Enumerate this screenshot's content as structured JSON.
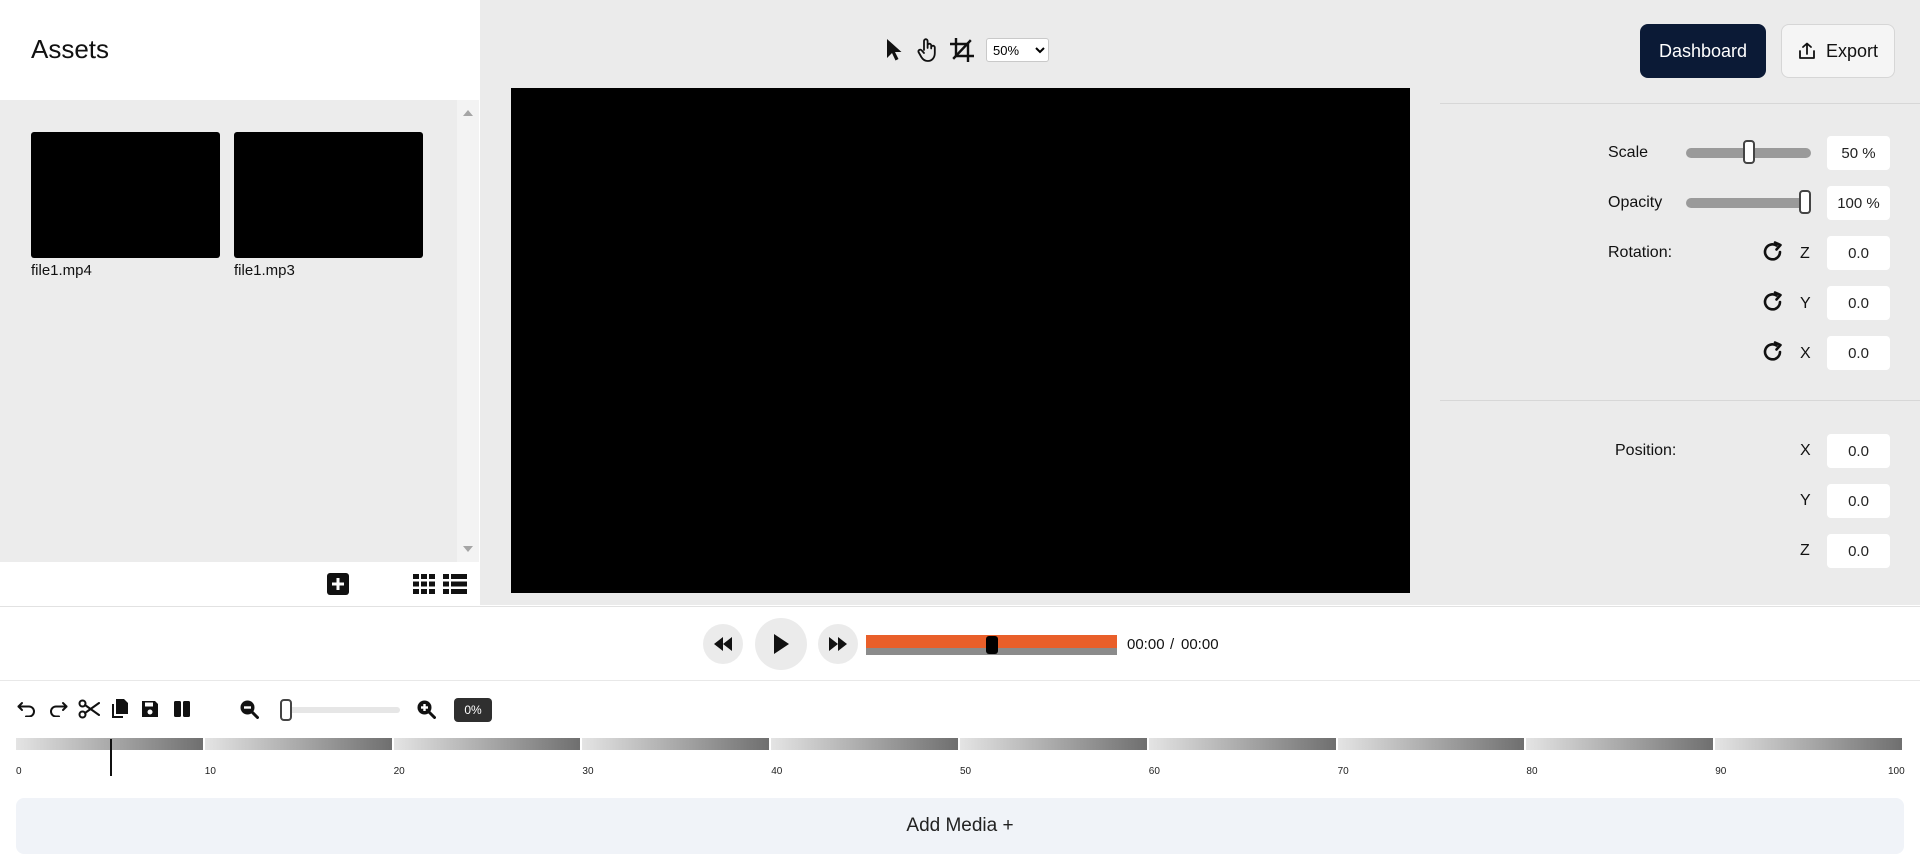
{
  "assets": {
    "title": "Assets",
    "items": [
      {
        "name": "file1.mp4"
      },
      {
        "name": "file1.mp3"
      }
    ]
  },
  "viewer": {
    "zoom_value": "50%",
    "zoom_options": [
      "50%"
    ]
  },
  "header": {
    "dashboard_label": "Dashboard",
    "export_label": "Export"
  },
  "properties": {
    "scale_label": "Scale",
    "scale_value": "50 %",
    "scale_level": 0.5,
    "opacity_label": "Opacity",
    "opacity_value": "100 %",
    "opacity_level": 1.0,
    "rotation_label": "Rotation:",
    "rotation": [
      {
        "axis": "Z",
        "value": "0.0"
      },
      {
        "axis": "Y",
        "value": "0.0"
      },
      {
        "axis": "X",
        "value": "0.0"
      }
    ],
    "position_label": "Position:",
    "position": [
      {
        "axis": "X",
        "value": "0.0"
      },
      {
        "axis": "Y",
        "value": "0.0"
      },
      {
        "axis": "Z",
        "value": "0.0"
      }
    ]
  },
  "transport": {
    "current_time": "00:00",
    "separator": "/",
    "total_time": "00:00",
    "progress_level": 0.5
  },
  "timeline": {
    "zoom_percent": "0%",
    "ruler_ticks": [
      "0",
      "10",
      "20",
      "30",
      "40",
      "50",
      "60",
      "70",
      "80",
      "90",
      "100"
    ],
    "playhead_at": 5
  },
  "add_media_label": "Add Media +",
  "colors": {
    "accent": "#e95f2a",
    "dashboard_bg": "#0b1a36"
  }
}
